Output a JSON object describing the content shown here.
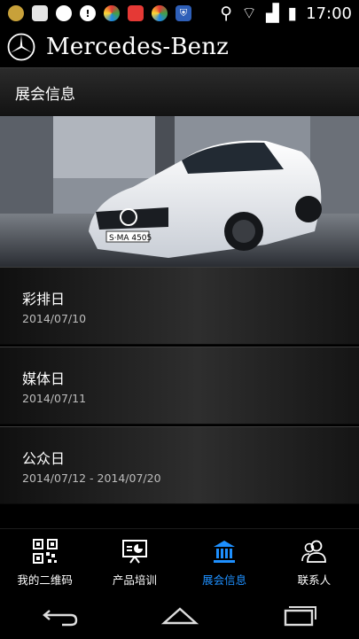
{
  "status_bar": {
    "time": "17:00"
  },
  "app": {
    "brand": "Mercedes-Benz"
  },
  "page": {
    "title": "展会信息"
  },
  "events": [
    {
      "name": "彩排日",
      "date": "2014/07/10"
    },
    {
      "name": "媒体日",
      "date": "2014/07/11"
    },
    {
      "name": "公众日",
      "date": "2014/07/12 - 2014/07/20"
    }
  ],
  "hero": {
    "plate": "S·MA 4505"
  },
  "tabs": [
    {
      "label": "我的二维码",
      "icon": "qr-code-icon"
    },
    {
      "label": "产品培训",
      "icon": "presentation-icon"
    },
    {
      "label": "展会信息",
      "icon": "exhibition-hall-icon",
      "active": true
    },
    {
      "label": "联系人",
      "icon": "contacts-icon"
    }
  ],
  "colors": {
    "accent": "#1e90ff"
  }
}
